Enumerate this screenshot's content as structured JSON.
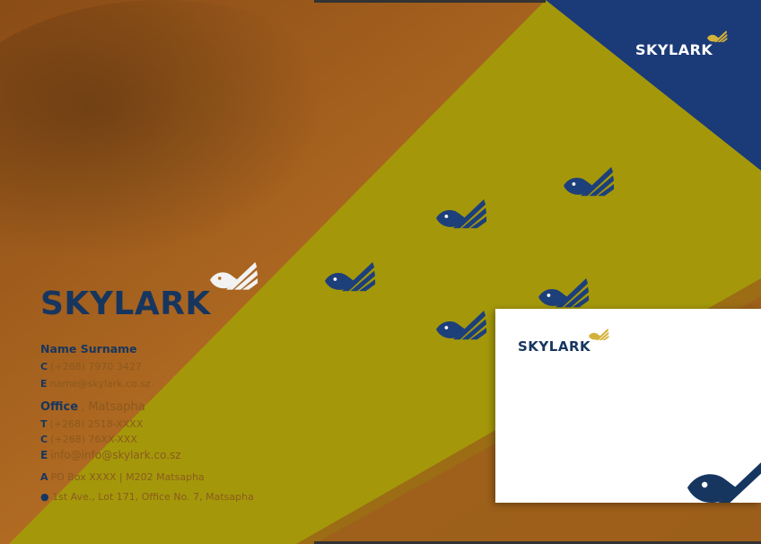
{
  "brand": {
    "name": "SKYLARK",
    "colors": {
      "navy": "#16365f",
      "gold": "#c9a227",
      "orange": "#b46a22",
      "olive": "#a09a08",
      "white": "#ffffff"
    }
  },
  "folder": {
    "logo_text": "SKYLARK",
    "corner_logo_text": "SKYLARK",
    "contact": {
      "name": "Name Surname",
      "cell_label": "C",
      "cell": "(+268) 7970 3427",
      "email_label": "E",
      "email": "name@skylark.co.sz",
      "office_bold": "Office",
      "office_rest": ", Matsapha",
      "tel_label": "T",
      "tel": "(+268) 2518-XXXX",
      "office_cell_label": "C",
      "office_cell": "(+268) 76XX-XXX",
      "office_email_label": "E",
      "office_email": "info@info@skylark.co.sz",
      "address_label": "A",
      "address": "PO Box XXXX | M202 Matsapha",
      "location": "1st Ave., Lot 171, Office No. 7, Matsapha"
    }
  },
  "envelope": {
    "logo_text": "SKYLARK"
  },
  "icons": [
    "bird-icon",
    "location-pin-icon"
  ]
}
